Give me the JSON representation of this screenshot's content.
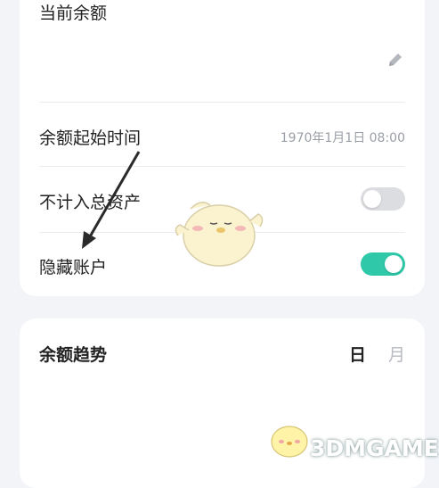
{
  "balance_section": {
    "title": "当前余额",
    "edit_icon": "pencil-icon"
  },
  "settings": {
    "start_time": {
      "label": "余额起始时间",
      "value": "1970年1月1日 08:00"
    },
    "exclude_total": {
      "label": "不计入总资产",
      "enabled": false
    },
    "hide_account": {
      "label": "隐藏账户",
      "enabled": true
    }
  },
  "trend": {
    "title": "余额趋势",
    "tabs": [
      {
        "label": "日",
        "selected": true
      },
      {
        "label": "月",
        "selected": false
      }
    ]
  },
  "watermark": {
    "text": "3DMGAME"
  },
  "colors": {
    "toggle_on": "#2fc8a8",
    "toggle_off": "#dcdde0",
    "background": "#f2f4f8"
  }
}
